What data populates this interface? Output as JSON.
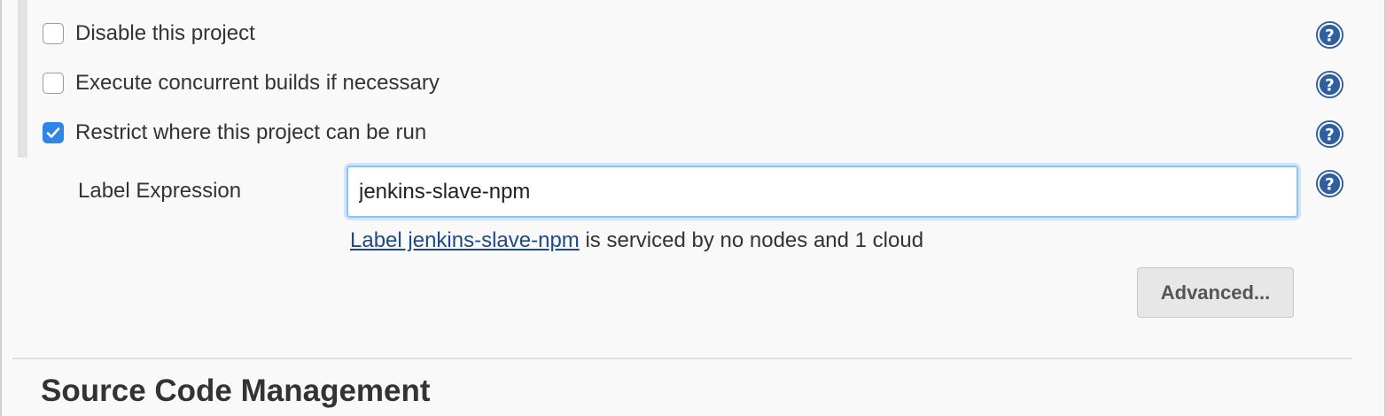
{
  "options": [
    {
      "label": "Disable this project",
      "checked": false
    },
    {
      "label": "Execute concurrent builds if necessary",
      "checked": false
    },
    {
      "label": "Restrict where this project can be run",
      "checked": true
    }
  ],
  "label_expression": {
    "label": "Label Expression",
    "value": "jenkins-slave-npm"
  },
  "status": {
    "link_text": "Label jenkins-slave-npm",
    "suffix": " is serviced by no nodes and 1 cloud"
  },
  "advanced_button": {
    "label": "Advanced..."
  },
  "next_section": {
    "title": "Source Code Management"
  },
  "colors": {
    "help_icon": "#2f5f9e",
    "checkbox_checked": "#2e87e8",
    "link": "#204a87",
    "input_focus": "#8fc2f4"
  },
  "icons": {
    "help": "question-mark-help-icon",
    "check": "checkmark-icon"
  }
}
